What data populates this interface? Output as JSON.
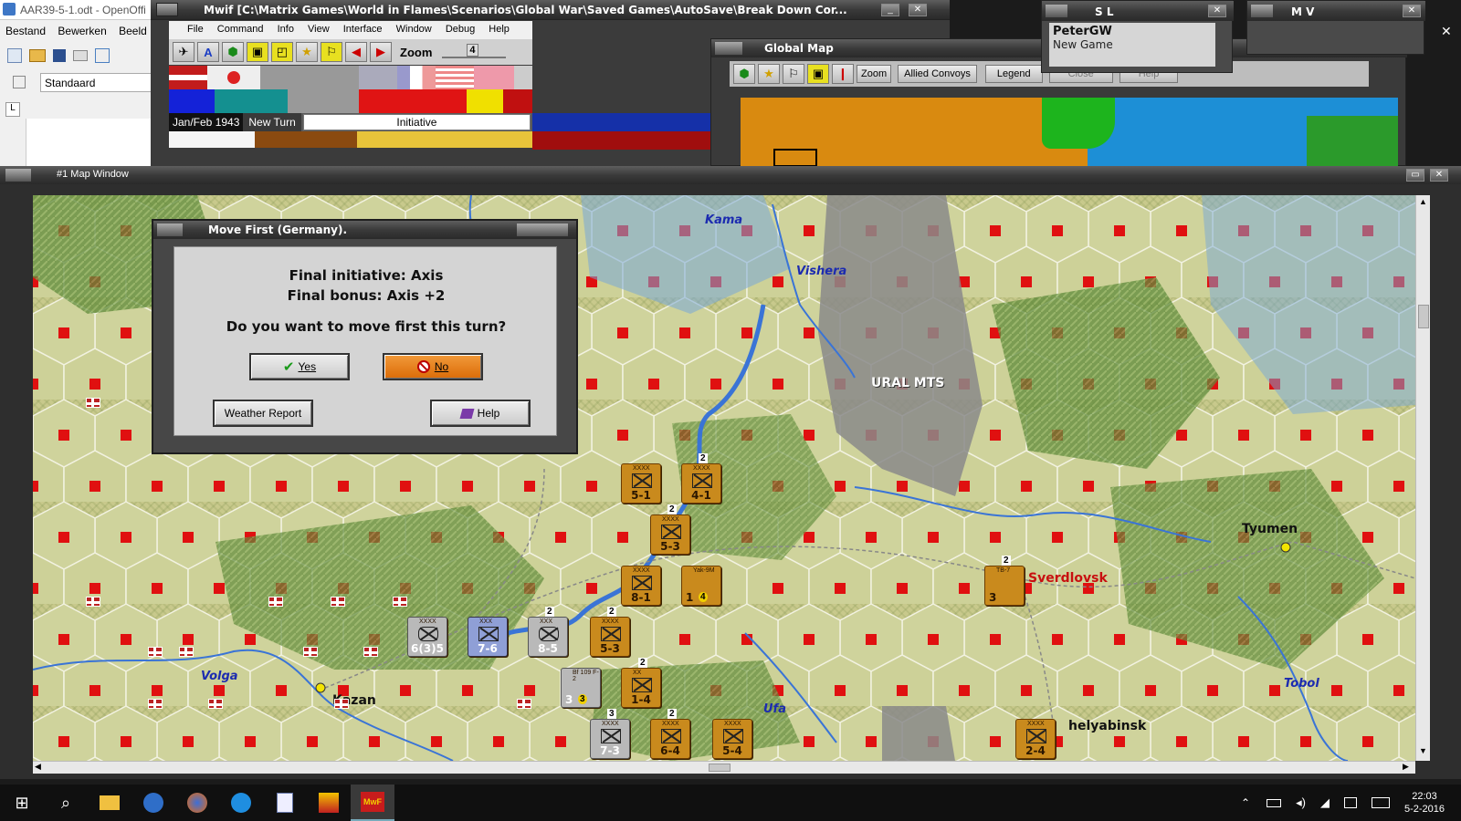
{
  "openoffice": {
    "title": "AAR39-5-1.odt - OpenOffi",
    "menu": [
      "Bestand",
      "Bewerken",
      "Beeld"
    ],
    "style_value": "Standaard"
  },
  "main_window": {
    "title": "Mwif [C:\\Matrix Games\\World in Flames\\Scenarios\\Global War\\Saved Games\\AutoSave\\Break Down Cor...",
    "menu": [
      "File",
      "Command",
      "Info",
      "View",
      "Interface",
      "Window",
      "Debug",
      "Help"
    ],
    "zoom_label": "Zoom",
    "zoom_value": "4",
    "date": "Jan/Feb 1943",
    "turn_phase": "New Turn",
    "phase_field": "Initiative"
  },
  "global_map": {
    "title": "Global Map",
    "buttons": [
      "Zoom",
      "Allied Convoys",
      "Legend",
      "Close",
      "Help"
    ]
  },
  "player_windows": [
    {
      "title": "S L",
      "name": "PeterGW",
      "status": "New Game"
    },
    {
      "title": "M V"
    }
  ],
  "map_window": {
    "title": "#1 Map Window",
    "labels": {
      "kama": "Kama",
      "vishera": "Vishera",
      "ural": "URAL MTS",
      "tyumen": "Tyumen",
      "sverdlovsk": "Sverdlovsk",
      "volga": "Volga",
      "kazan": "Kazan",
      "ufa": "Ufa",
      "tobol": "Tobol",
      "chelyabinsk": "helyabinsk"
    },
    "units": [
      {
        "stat": "5-1",
        "size": "XXXX",
        "badge": ""
      },
      {
        "stat": "4-1",
        "size": "XXXX",
        "badge": "2"
      },
      {
        "stat": "5-3",
        "size": "XXXX",
        "badge": "2"
      },
      {
        "stat": "8-1",
        "size": "XXXX",
        "badge": ""
      },
      {
        "stat": "1",
        "size": "Yak-9M",
        "badge": "4"
      },
      {
        "stat": "6(3)5",
        "size": "XXXX",
        "badge": ""
      },
      {
        "stat": "7-6",
        "size": "XXX",
        "badge": ""
      },
      {
        "stat": "8-5",
        "size": "XXX",
        "badge": "2"
      },
      {
        "stat": "5-3",
        "size": "XXXX",
        "badge": "2"
      },
      {
        "stat": "1-4",
        "size": "XX",
        "badge": "2"
      },
      {
        "stat": "3",
        "size": "Bf 109 F-2",
        "badge": "3"
      },
      {
        "stat": "7-3",
        "size": "XXXX",
        "badge": "3"
      },
      {
        "stat": "6-4",
        "size": "XXXX",
        "badge": "2"
      },
      {
        "stat": "5-4",
        "size": "XXXX",
        "badge": ""
      },
      {
        "stat": "2-4",
        "size": "XXXX",
        "badge": ""
      },
      {
        "stat": "3",
        "size": "TB-7",
        "badge": "2"
      }
    ]
  },
  "dialog": {
    "title": "Move First (Germany).",
    "line1": "Final initiative: Axis",
    "line2": "Final bonus: Axis +2",
    "question": "Do you want to move first this turn?",
    "yes": "Yes",
    "no": "No",
    "weather": "Weather Report",
    "help": "Help"
  },
  "taskbar": {
    "time": "22:03",
    "date": "5-2-2016"
  },
  "colors": {
    "unit_orange": "#c98a1d",
    "river_blue": "#3a74d6",
    "no_button": "#e27a12"
  }
}
